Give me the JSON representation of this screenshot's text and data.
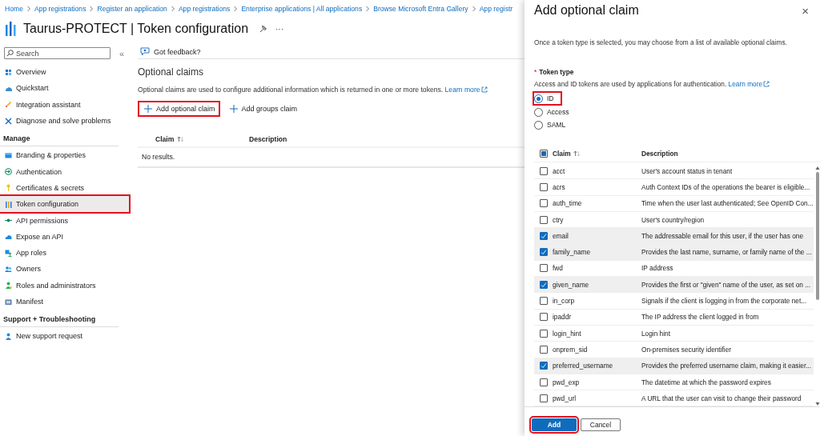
{
  "breadcrumb": [
    {
      "label": "Home"
    },
    {
      "label": "App registrations"
    },
    {
      "label": "Register an application"
    },
    {
      "label": "App registrations"
    },
    {
      "label": "Enterprise applications | All applications"
    },
    {
      "label": "Browse Microsoft Entra Gallery"
    },
    {
      "label": "App registr"
    }
  ],
  "page_title": "Taurus-PROTECT | Token configuration",
  "title_actions": [
    "···"
  ],
  "sidebar": {
    "search": {
      "placeholder": "Search"
    },
    "collapse": "«",
    "groups": [
      {
        "items": [
          {
            "label": "Overview",
            "selected": false,
            "highlighted": false
          },
          {
            "label": "Quickstart",
            "selected": false,
            "highlighted": false
          },
          {
            "label": "Integration assistant",
            "selected": false,
            "highlighted": false
          },
          {
            "label": "Diagnose and solve problems",
            "selected": false,
            "highlighted": false
          }
        ]
      },
      {
        "header": "Manage",
        "items": [
          {
            "label": "Branding & properties",
            "selected": false,
            "highlighted": false
          },
          {
            "label": "Authentication",
            "selected": false,
            "highlighted": false
          },
          {
            "label": "Certificates & secrets",
            "selected": false,
            "highlighted": false
          },
          {
            "label": "Token configuration",
            "selected": true,
            "highlighted": true
          },
          {
            "label": "API permissions",
            "selected": false,
            "highlighted": false
          },
          {
            "label": "Expose an API",
            "selected": false,
            "highlighted": false
          },
          {
            "label": "App roles",
            "selected": false,
            "highlighted": false
          },
          {
            "label": "Owners",
            "selected": false,
            "highlighted": false
          },
          {
            "label": "Roles and administrators",
            "selected": false,
            "highlighted": false
          },
          {
            "label": "Manifest",
            "selected": false,
            "highlighted": false
          }
        ]
      },
      {
        "header": "Support + Troubleshooting",
        "items": [
          {
            "label": "New support request",
            "selected": false,
            "highlighted": false
          }
        ]
      }
    ]
  },
  "main": {
    "feedback": "Got feedback?",
    "heading": "Optional claims",
    "description": "Optional claims are used to configure additional information which is returned in one or more tokens.",
    "learn_more": "Learn more",
    "actions": [
      {
        "label": "Add optional claim",
        "highlighted": true
      },
      {
        "label": "Add groups claim",
        "highlighted": false
      }
    ],
    "table": {
      "columns": [
        "Claim",
        "Description"
      ],
      "empty": "No results."
    }
  },
  "panel": {
    "title": "Add optional claim",
    "close": "×",
    "intro": "Once a token type is selected, you may choose from a list of available optional claims.",
    "token_type": {
      "label": "Token type",
      "required_mark": "*",
      "help": "Access and ID tokens are used by applications for authentication.",
      "learn_more": "Learn more",
      "options": [
        {
          "label": "ID",
          "selected": true,
          "highlighted": true
        },
        {
          "label": "Access",
          "selected": false,
          "highlighted": false
        },
        {
          "label": "SAML",
          "selected": false,
          "highlighted": false
        }
      ]
    },
    "table": {
      "select_all": {
        "indeterminate": true
      },
      "columns": [
        "Claim",
        "Description"
      ],
      "rows": [
        {
          "claim": "acct",
          "description": "User's account status in tenant",
          "checked": false
        },
        {
          "claim": "acrs",
          "description": "Auth Context IDs of the operations the bearer is eligible...",
          "checked": false
        },
        {
          "claim": "auth_time",
          "description": "Time when the user last authenticated; See OpenID Con...",
          "checked": false
        },
        {
          "claim": "ctry",
          "description": "User's country/region",
          "checked": false
        },
        {
          "claim": "email",
          "description": "The addressable email for this user, if the user has one",
          "checked": true
        },
        {
          "claim": "family_name",
          "description": "Provides the last name, surname, or family name of the ...",
          "checked": true
        },
        {
          "claim": "fwd",
          "description": "IP address",
          "checked": false
        },
        {
          "claim": "given_name",
          "description": "Provides the first or \"given\" name of the user, as set on ...",
          "checked": true
        },
        {
          "claim": "in_corp",
          "description": "Signals if the client is logging in from the corporate net...",
          "checked": false
        },
        {
          "claim": "ipaddr",
          "description": "The IP address the client logged in from",
          "checked": false
        },
        {
          "claim": "login_hint",
          "description": "Login hint",
          "checked": false
        },
        {
          "claim": "onprem_sid",
          "description": "On-premises security identifier",
          "checked": false
        },
        {
          "claim": "preferred_username",
          "description": "Provides the preferred username claim, making it easier...",
          "checked": true
        },
        {
          "claim": "pwd_exp",
          "description": "The datetime at which the password expires",
          "checked": false
        },
        {
          "claim": "pwd_url",
          "description": "A URL that the user can visit to change their password",
          "checked": false
        }
      ]
    },
    "buttons": [
      {
        "label": "Add",
        "kind": "primary",
        "highlighted": true
      },
      {
        "label": "Cancel",
        "kind": "secondary",
        "highlighted": false
      }
    ]
  }
}
